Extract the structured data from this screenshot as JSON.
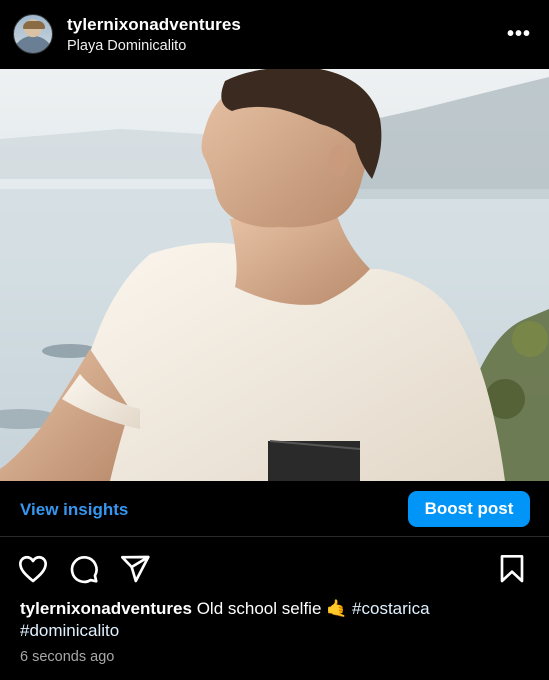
{
  "post": {
    "username": "tylernixonadventures",
    "location": "Playa Dominicalito",
    "more_label": "•••",
    "caption_user": "tylernixonadventures",
    "caption_text": "Old school selfie 🤙",
    "hashtag_1": "#costarica",
    "hashtag_2": "#dominicalito",
    "timestamp": "6 seconds ago"
  },
  "actions": {
    "view_insights": "View insights",
    "boost_post": "Boost post"
  },
  "icons": {
    "like": "heart-icon",
    "comment": "comment-icon",
    "share": "send-icon",
    "save": "bookmark-icon",
    "menu": "more-icon"
  },
  "colors": {
    "background": "#000000",
    "link_blue": "#3797f0",
    "button_blue": "#0095f6",
    "muted": "#a8a8a8"
  }
}
